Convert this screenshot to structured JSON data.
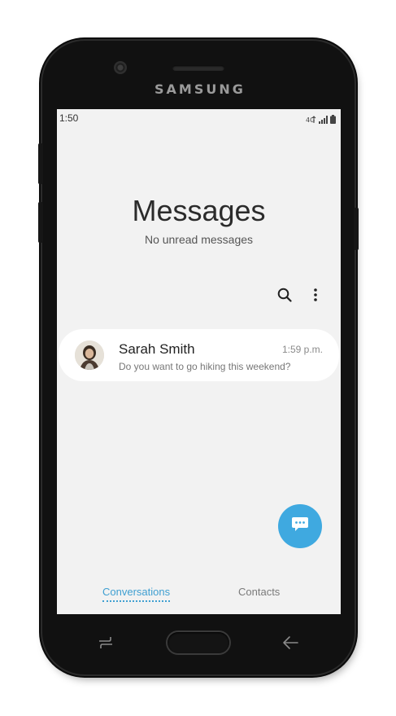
{
  "device": {
    "brand": "SAMSUNG"
  },
  "status_bar": {
    "time": "1:50",
    "icons": [
      "volte-icon",
      "signal-icon",
      "battery-icon"
    ]
  },
  "header": {
    "title": "Messages",
    "subtitle": "No unread messages"
  },
  "toolbar": {
    "icons": [
      "search-icon",
      "more-options-icon"
    ]
  },
  "conversations": [
    {
      "name": "Sarah Smith",
      "time": "1:59 p.m.",
      "preview": "Do you want to go hiking this weekend?"
    }
  ],
  "fab": {
    "icon": "new-message-icon",
    "color": "#3fa9e0"
  },
  "tabs": [
    {
      "label": "Conversations",
      "active": true
    },
    {
      "label": "Contacts",
      "active": false
    }
  ],
  "nav_bar": {
    "icons": [
      "recent-apps-icon",
      "home-button",
      "back-icon"
    ]
  },
  "colors": {
    "accent": "#3f9fd1",
    "background": "#f2f2f2"
  }
}
